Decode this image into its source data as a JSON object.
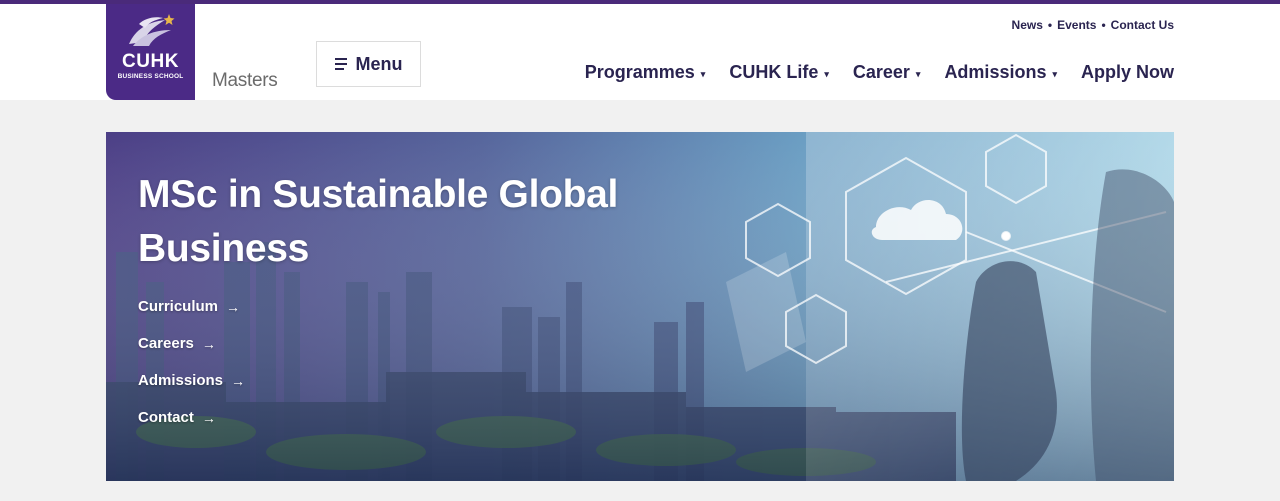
{
  "brand": {
    "name": "CUHK",
    "subtitle": "BUSINESS SCHOOL",
    "section": "Masters",
    "color": "#4b2a86"
  },
  "header": {
    "menu_label": "Menu",
    "utility_links": [
      "News",
      "Events",
      "Contact Us"
    ],
    "separator": "•",
    "nav": [
      {
        "label": "Programmes",
        "has_dropdown": true
      },
      {
        "label": "CUHK Life",
        "has_dropdown": true
      },
      {
        "label": "Career",
        "has_dropdown": true
      },
      {
        "label": "Admissions",
        "has_dropdown": true
      },
      {
        "label": "Apply Now",
        "has_dropdown": false
      }
    ],
    "caret": "▾"
  },
  "hero": {
    "title": "MSc in Sustainable Global Business",
    "arrow": "→",
    "links": [
      "Curriculum",
      "Careers",
      "Admissions",
      "Contact"
    ]
  },
  "colors": {
    "accent": "#4a2a7a",
    "nav_text": "#2a2450",
    "page_bg": "#f1f1f1"
  }
}
